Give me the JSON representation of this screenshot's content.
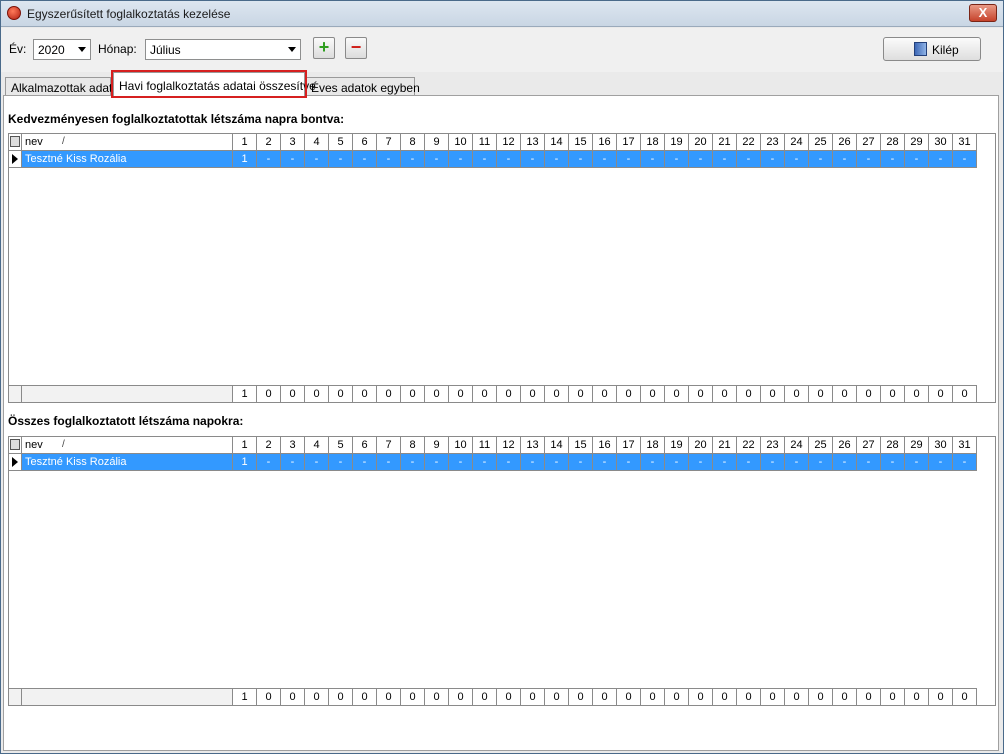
{
  "window": {
    "title": "Egyszerűsített foglalkoztatás kezelése",
    "close_label": "X"
  },
  "toolbar": {
    "year_label": "Év:",
    "year_value": "2020",
    "month_label": "Hónap:",
    "month_value": "Július",
    "add_label": "+",
    "remove_label": "−",
    "exit_label": "Kilép"
  },
  "tabs": [
    {
      "label": "Alkalmazottak adatai"
    },
    {
      "label": "Havi foglalkoztatás adatai összesítve"
    },
    {
      "label": "Éves adatok egyben"
    }
  ],
  "section1": {
    "title": "Kedvezményesen foglalkoztatottak létszáma napra bontva:",
    "name_header": "nev",
    "sort_mark": "/",
    "row_name": "Tesztné Kiss Rozália",
    "row_values": [
      "1",
      "-",
      "-",
      "-",
      "-",
      "-",
      "-",
      "-",
      "-",
      "-",
      "-",
      "-",
      "-",
      "-",
      "-",
      "-",
      "-",
      "-",
      "-",
      "-",
      "-",
      "-",
      "-",
      "-",
      "-",
      "-",
      "-",
      "-",
      "-",
      "-",
      "-"
    ],
    "footer_values": [
      "1",
      "0",
      "0",
      "0",
      "0",
      "0",
      "0",
      "0",
      "0",
      "0",
      "0",
      "0",
      "0",
      "0",
      "0",
      "0",
      "0",
      "0",
      "0",
      "0",
      "0",
      "0",
      "0",
      "0",
      "0",
      "0",
      "0",
      "0",
      "0",
      "0",
      "0"
    ]
  },
  "section2": {
    "title": "Összes foglalkoztatott létszáma napokra:",
    "name_header": "nev",
    "sort_mark": "/",
    "row_name": "Tesztné Kiss Rozália",
    "row_values": [
      "1",
      "-",
      "-",
      "-",
      "-",
      "-",
      "-",
      "-",
      "-",
      "-",
      "-",
      "-",
      "-",
      "-",
      "-",
      "-",
      "-",
      "-",
      "-",
      "-",
      "-",
      "-",
      "-",
      "-",
      "-",
      "-",
      "-",
      "-",
      "-",
      "-",
      "-"
    ],
    "footer_values": [
      "1",
      "0",
      "0",
      "0",
      "0",
      "0",
      "0",
      "0",
      "0",
      "0",
      "0",
      "0",
      "0",
      "0",
      "0",
      "0",
      "0",
      "0",
      "0",
      "0",
      "0",
      "0",
      "0",
      "0",
      "0",
      "0",
      "0",
      "0",
      "0",
      "0",
      "0"
    ]
  },
  "days": [
    "1",
    "2",
    "3",
    "4",
    "5",
    "6",
    "7",
    "8",
    "9",
    "10",
    "11",
    "12",
    "13",
    "14",
    "15",
    "16",
    "17",
    "18",
    "19",
    "20",
    "21",
    "22",
    "23",
    "24",
    "25",
    "26",
    "27",
    "28",
    "29",
    "30",
    "31"
  ]
}
